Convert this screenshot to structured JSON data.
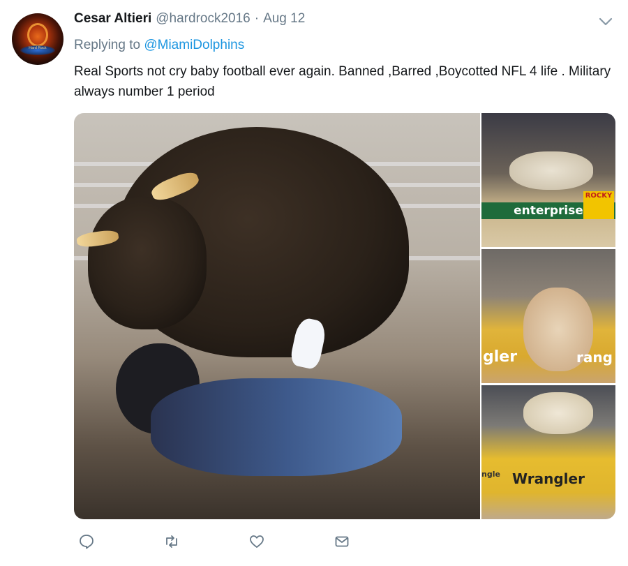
{
  "tweet": {
    "author_name": "Cesar Altieri",
    "author_handle": "@hardrock2016",
    "separator": "·",
    "date": "Aug 12",
    "replying_prefix": "Replying to",
    "replying_to": "@MiamiDolphins",
    "text": "Real Sports not cry baby football ever again. Banned ,Barred ,Boycotted NFL 4 life . Military always number 1 period"
  },
  "media": {
    "thumb1_banner": "enterprise",
    "thumb1_side": "ROCKY",
    "thumb2_banner": "gler",
    "thumb2_side": "rang",
    "thumb3_banner": "Wrangler",
    "thumb3_side": "ngle"
  },
  "icons": {
    "avatar_label": "Hard Rock",
    "caret": "chevron-down-icon",
    "reply": "reply-icon",
    "retweet": "retweet-icon",
    "like": "heart-icon",
    "dm": "mail-icon"
  },
  "colors": {
    "text": "#14171a",
    "muted": "#657786",
    "link": "#1b95e0"
  }
}
